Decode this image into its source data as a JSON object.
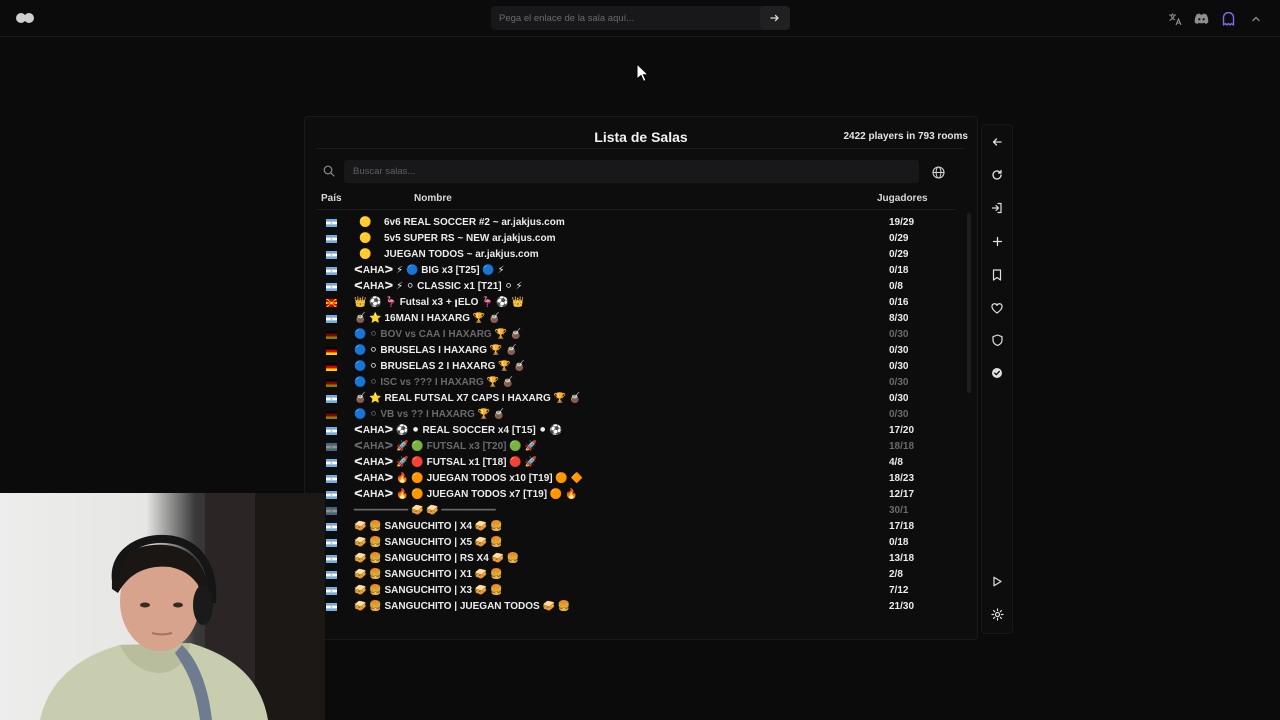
{
  "topbar": {
    "link_placeholder": "Pega el enlace de la sala aquí...",
    "icons": [
      "logo-icon",
      "arrow-right-icon",
      "translate-icon",
      "discord-icon",
      "ghost-icon",
      "chevron-up-icon"
    ]
  },
  "panel": {
    "title": "Lista de Salas",
    "count": "2422 players in 793 rooms",
    "search_placeholder": "Buscar salas...",
    "headers": {
      "pais": "País",
      "nombre": "Nombre",
      "jugadores": "Jugadores"
    }
  },
  "rooms": [
    {
      "flag": "ar",
      "icons": "🟡",
      "name": "6v6 REAL SOCCER #2 ~ ar.jakjus.com",
      "players": "19/29",
      "dim": false
    },
    {
      "flag": "ar",
      "icons": "🟡",
      "name": "5v5 SUPER RS ~ NEW ar.jakjus.com",
      "players": "0/29",
      "dim": false
    },
    {
      "flag": "ar",
      "icons": "🟡",
      "name": "JUEGAN TODOS ~ ar.jakjus.com",
      "players": "0/29",
      "dim": false
    },
    {
      "flag": "ar",
      "icons": "",
      "name": "ᐸAHAᐳ ⚡ 🔵 BIG x3 [T25] 🔵 ⚡",
      "players": "0/18",
      "dim": false
    },
    {
      "flag": "ar",
      "icons": "",
      "name": "ᐸAHAᐳ ⚡ ⚪ CLASSIC x1 [T21] ⚪ ⚡",
      "players": "0/8",
      "dim": false
    },
    {
      "flag": "mk",
      "icons": "",
      "name": "👑 ⚽ 🦩 Futsal x3 + ꞁELO 🦩 ⚽ 👑",
      "players": "0/16",
      "dim": false
    },
    {
      "flag": "ar",
      "icons": "",
      "name": "🧉 ⭐ 16MAN I HAXARG 🏆 🧉",
      "players": "8/30",
      "dim": false
    },
    {
      "flag": "de",
      "icons": "",
      "name": "🔵 ⚪ BOV vs CAA I HAXARG 🏆 🧉",
      "players": "0/30",
      "dim": true
    },
    {
      "flag": "de",
      "icons": "",
      "name": "🔵 ⚪ BRUSELAS I HAXARG 🏆 🧉",
      "players": "0/30",
      "dim": false
    },
    {
      "flag": "de",
      "icons": "",
      "name": "🔵 ⚪ BRUSELAS 2 I HAXARG 🏆 🧉",
      "players": "0/30",
      "dim": false
    },
    {
      "flag": "de",
      "icons": "",
      "name": "🔵 ⚪ ISC vs ??? I HAXARG 🏆 🧉",
      "players": "0/30",
      "dim": true
    },
    {
      "flag": "ar",
      "icons": "",
      "name": "🧉 ⭐ REAL FUTSAL X7 CAPS I HAXARG 🏆 🧉",
      "players": "0/30",
      "dim": false
    },
    {
      "flag": "de",
      "icons": "",
      "name": "🔵 ⚪ VB vs ?? I HAXARG 🏆 🧉",
      "players": "0/30",
      "dim": true
    },
    {
      "flag": "ar",
      "icons": "",
      "name": "ᐸAHAᐳ ⚽ ⚫ REAL SOCCER x4 [T15] ⚫ ⚽",
      "players": "17/20",
      "dim": false
    },
    {
      "flag": "ar",
      "icons": "",
      "name": "ᐸAHAᐳ 🚀 🟢 FUTSAL x3 [T20] 🟢 🚀",
      "players": "18/18",
      "dim": true
    },
    {
      "flag": "ar",
      "icons": "",
      "name": "ᐸAHAᐳ 🚀 🔴 FUTSAL x1 [T18] 🔴 🚀",
      "players": "4/8",
      "dim": false
    },
    {
      "flag": "ar",
      "icons": "",
      "name": "ᐸAHAᐳ 🔥 🟠 JUEGAN TODOS x10 [T19] 🟠 🔶",
      "players": "18/23",
      "dim": false
    },
    {
      "flag": "ar",
      "icons": "",
      "name": "ᐸAHAᐳ 🔥 🟠 JUEGAN TODOS x7 [T19] 🟠 🔥",
      "players": "12/17",
      "dim": false
    },
    {
      "flag": "ar",
      "icons": "",
      "name": "━━━━━━━━━ 🥪 🥪 ━━━━━━━━━",
      "players": "30/1",
      "dim": true
    },
    {
      "flag": "ar",
      "icons": "",
      "name": "🥪 🍔 SANGUCHITO | X4 🥪 🍔",
      "players": "17/18",
      "dim": false
    },
    {
      "flag": "ar",
      "icons": "",
      "name": "🥪 🍔 SANGUCHITO | X5 🥪 🍔",
      "players": "0/18",
      "dim": false
    },
    {
      "flag": "ar",
      "icons": "",
      "name": "🥪 🍔 SANGUCHITO | RS X4 🥪 🍔",
      "players": "13/18",
      "dim": false
    },
    {
      "flag": "ar",
      "icons": "",
      "name": "🥪 🍔 SANGUCHITO | X1 🥪 🍔",
      "players": "2/8",
      "dim": false
    },
    {
      "flag": "ar",
      "icons": "",
      "name": "🥪 🍔 SANGUCHITO | X3 🥪 🍔",
      "players": "7/12",
      "dim": false
    },
    {
      "flag": "ar",
      "icons": "",
      "name": "🥪 🍔 SANGUCHITO | JUEGAN TODOS 🥪 🍔",
      "players": "21/30",
      "dim": false
    }
  ],
  "sidebar_icons": [
    "back-arrow-icon",
    "refresh-icon",
    "login-icon",
    "plus-icon",
    "bookmark-icon",
    "heart-icon",
    "shield-icon",
    "verified-icon",
    "play-icon",
    "settings-gear-icon"
  ],
  "colors": {
    "background": "#0b0b0c",
    "panel": "#0d0d0e",
    "input": "#18181a",
    "text": "#ececec",
    "dim_text": "#6a6a6e",
    "accent_ghost": "#7b6cf0"
  }
}
